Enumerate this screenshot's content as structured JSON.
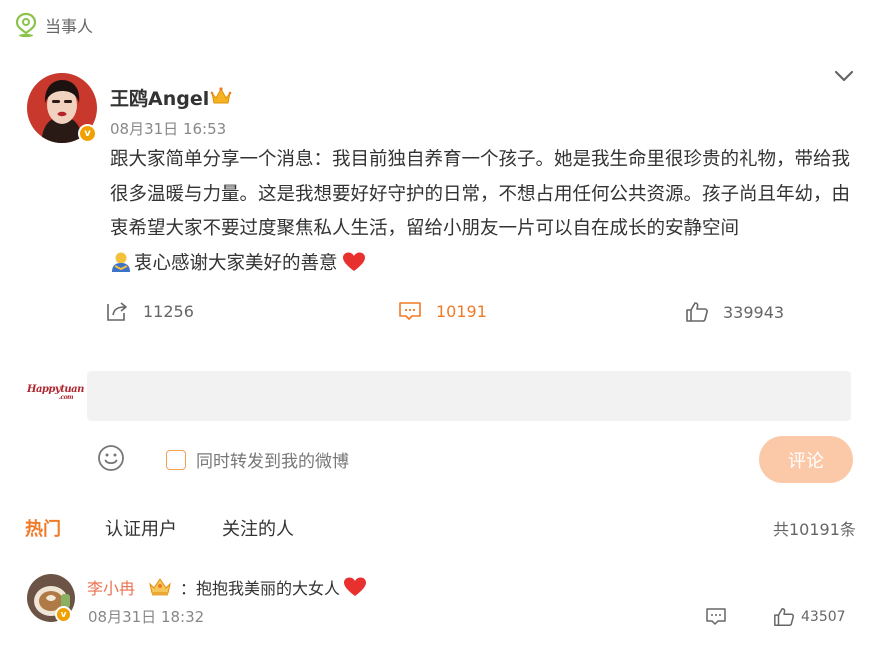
{
  "topic": {
    "label": "当事人"
  },
  "post": {
    "author": "王鸥Angel",
    "time": "08月31日 16:53",
    "text": "跟大家简单分享一个消息：我目前独自养育一个孩子。她是我生命里很珍贵的礼物，带给我很多温暖与力量。这是我想要好好守护的日常，不想占用任何公共资源。孩子尚且年幼，由衷希望大家不要过度聚焦私人生活，留给小朋友一片可以自在成长的安静空间",
    "text_tail": "衷心感谢大家美好的善意",
    "repost_count": "11256",
    "comment_count": "10191",
    "like_count": "339943"
  },
  "composer": {
    "avatar_text": "Happytuan",
    "avatar_sub": ".com",
    "input_value": "",
    "share_label": "同时转发到我的微博",
    "submit_label": "评论"
  },
  "tabs": {
    "hot": "热门",
    "verified": "认证用户",
    "following": "关注的人",
    "total": "共10191条"
  },
  "comment": {
    "user": "李小冉",
    "text": "：抱抱我美丽的大女人",
    "time": "08月31日 18:32",
    "like_count": "43507"
  },
  "colors": {
    "accent": "#f07a28",
    "username": "#eb7350",
    "submit_bg": "#fbc9a8",
    "verified_badge": "#f0a000"
  },
  "icons": [
    "location-pin-icon",
    "chevron-down-icon",
    "repost-icon",
    "comment-icon",
    "thumbs-up-icon",
    "smiley-icon",
    "crown-icon",
    "heart-icon",
    "hug-icon",
    "verified-badge-icon"
  ]
}
